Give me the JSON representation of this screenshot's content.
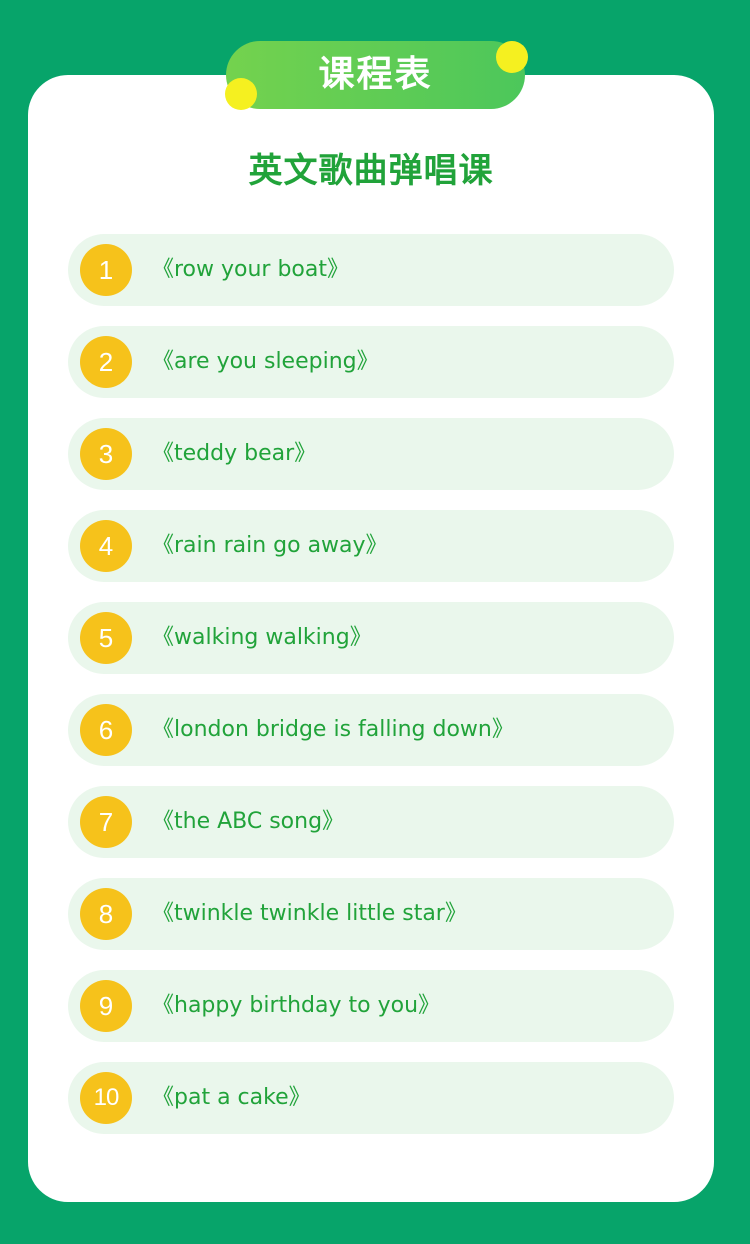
{
  "header": {
    "badge_title": "课程表"
  },
  "course": {
    "subtitle": "英文歌曲弹唱课",
    "items": [
      {
        "number": "1",
        "title": "《row your boat》"
      },
      {
        "number": "2",
        "title": "《are you sleeping》"
      },
      {
        "number": "3",
        "title": "《teddy bear》"
      },
      {
        "number": "4",
        "title": "《rain rain go away》"
      },
      {
        "number": "5",
        "title": "《walking walking》"
      },
      {
        "number": "6",
        "title": "《london bridge is falling down》"
      },
      {
        "number": "7",
        "title": "《the ABC song》"
      },
      {
        "number": "8",
        "title": "《twinkle twinkle little star》"
      },
      {
        "number": "9",
        "title": "《happy birthday to you》"
      },
      {
        "number": "10",
        "title": "《pat a cake》"
      }
    ]
  },
  "colors": {
    "background": "#07a46a",
    "card": "#ffffff",
    "badge_gradient_start": "#74d24e",
    "badge_gradient_end": "#4cc75b",
    "accent_text": "#21a33a",
    "row_background": "#eaf7ec",
    "number_badge": "#f6c21b",
    "decor_dot": "#f5f020"
  }
}
